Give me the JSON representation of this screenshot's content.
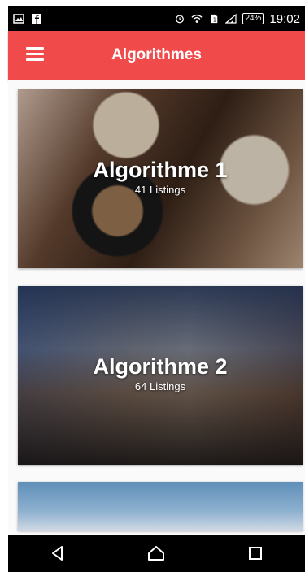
{
  "status_bar": {
    "battery": "24%",
    "time": "19:02"
  },
  "app_bar": {
    "title": "Algorithmes"
  },
  "cards": [
    {
      "title": "Algorithme 1",
      "subtitle": "41 Listings"
    },
    {
      "title": "Algorithme 2",
      "subtitle": "64 Listings"
    }
  ],
  "colors": {
    "accent": "#f04a4a",
    "status_bar": "#000000",
    "nav_bar": "#000000"
  },
  "icons": {
    "status_left": [
      "image-icon",
      "facebook-icon"
    ],
    "status_right": [
      "alarm-icon",
      "wifi-icon",
      "sim-icon",
      "signal-icon",
      "battery-icon"
    ],
    "nav": [
      "back-icon",
      "home-icon",
      "recents-icon"
    ]
  }
}
